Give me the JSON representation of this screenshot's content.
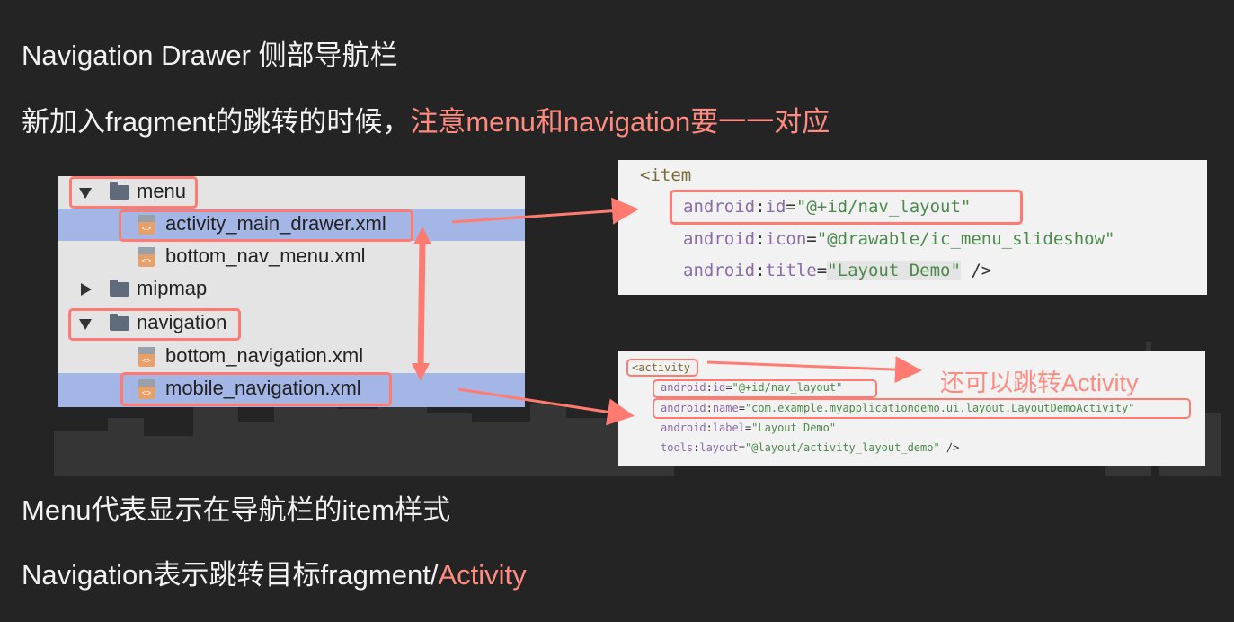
{
  "title": "Navigation Drawer 侧部导航栏",
  "line1": {
    "prefix": "新加入fragment的跳转的时候，",
    "highlight": "注意menu和navigation要一一对应"
  },
  "tree": {
    "items": [
      {
        "label": "menu",
        "type": "folder",
        "expanded": true
      },
      {
        "label": "activity_main_drawer.xml",
        "type": "xml-file",
        "selected": true
      },
      {
        "label": "bottom_nav_menu.xml",
        "type": "xml-file"
      },
      {
        "label": "mipmap",
        "type": "folder",
        "expanded": false
      },
      {
        "label": "navigation",
        "type": "folder",
        "expanded": true
      },
      {
        "label": "bottom_navigation.xml",
        "type": "xml-file"
      },
      {
        "label": "mobile_navigation.xml",
        "type": "xml-file",
        "selected": true
      }
    ]
  },
  "code1": {
    "tag": "<item",
    "lines": [
      {
        "ns": "android",
        "attr": "id",
        "value": "\"@+id/nav_layout\""
      },
      {
        "ns": "android",
        "attr": "icon",
        "value": "\"@drawable/ic_menu_slideshow\""
      },
      {
        "ns": "android",
        "attr": "title",
        "value": "\"Layout Demo\"",
        "end": " />"
      }
    ]
  },
  "code2": {
    "tag": "<activity",
    "lines": [
      {
        "ns": "android",
        "attr": "id",
        "value": "\"@+id/nav_layout\""
      },
      {
        "ns": "android",
        "attr": "name",
        "value": "\"com.example.myapplicationdemo.ui.layout.LayoutDemoActivity\""
      },
      {
        "ns": "android",
        "attr": "label",
        "value": "\"Layout Demo\""
      },
      {
        "ns": "tools",
        "attr": "layout",
        "value": "\"@layout/activity_layout_demo\"",
        "end": " />"
      }
    ]
  },
  "note": "还可以跳转Activity",
  "line3": "Menu代表显示在导航栏的item样式",
  "line4": {
    "prefix": "Navigation表示跳转目标fragment/",
    "highlight": "Activity"
  },
  "colors": {
    "background": "#242424",
    "highlight": "#ff8a80",
    "box": "#ff7b72",
    "selection": "#a4b6e6"
  }
}
